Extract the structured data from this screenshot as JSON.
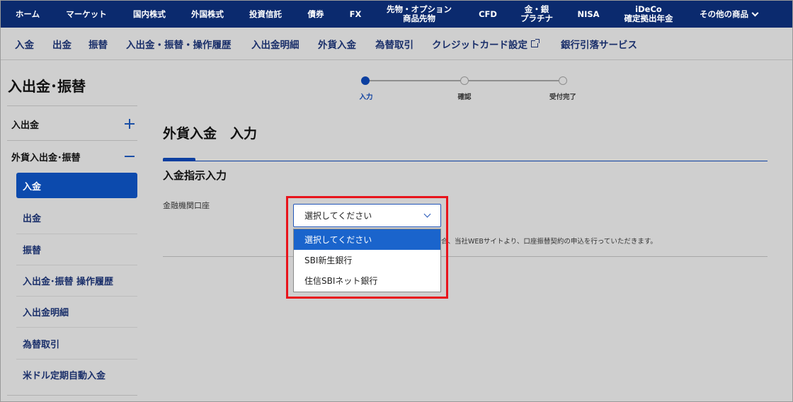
{
  "topnav": {
    "items": [
      {
        "label": "ホーム"
      },
      {
        "label": "マーケット"
      },
      {
        "label": "国内株式"
      },
      {
        "label": "外国株式"
      },
      {
        "label": "投資信託"
      },
      {
        "label": "債券"
      },
      {
        "label": "FX"
      },
      {
        "label1": "先物・オプション",
        "label2": "商品先物"
      },
      {
        "label": "CFD"
      },
      {
        "label1": "金・銀",
        "label2": "プラチナ"
      },
      {
        "label": "NISA"
      },
      {
        "label1": "iDeCo",
        "label2": "確定拠出年金"
      },
      {
        "label": "その他の商品"
      }
    ]
  },
  "subnav": {
    "items": [
      "入金",
      "出金",
      "振替",
      "入出金・振替・操作履歴",
      "入出金明細",
      "外貨入金",
      "為替取引",
      "クレジットカード設定",
      "銀行引落サービス"
    ]
  },
  "sidebar": {
    "title": "入出金･振替",
    "groups": [
      {
        "label": "入出金"
      },
      {
        "label": "外貨入出金･振替"
      }
    ],
    "items": [
      "入金",
      "出金",
      "振替",
      "入出金･振替 操作履歴",
      "入出金明細",
      "為替取引",
      "米ドル定期自動入金"
    ]
  },
  "steps": [
    "入力",
    "確認",
    "受付完了"
  ],
  "main": {
    "title": "外貨入金　入力",
    "section": "入金指示入力",
    "field_label": "金融機関口座",
    "select_value": "選択してください",
    "options": [
      "選択してください",
      "SBI新生銀行",
      "住信SBIネット銀行"
    ],
    "note": "合、当社WEBサイトより、口座振替契約の申込を行っていただきます。"
  },
  "colors": {
    "topnav_bg": "#0b2a6e",
    "accent": "#0c4aad",
    "selected_option": "#1a64cc",
    "highlight": "#e8141c"
  }
}
